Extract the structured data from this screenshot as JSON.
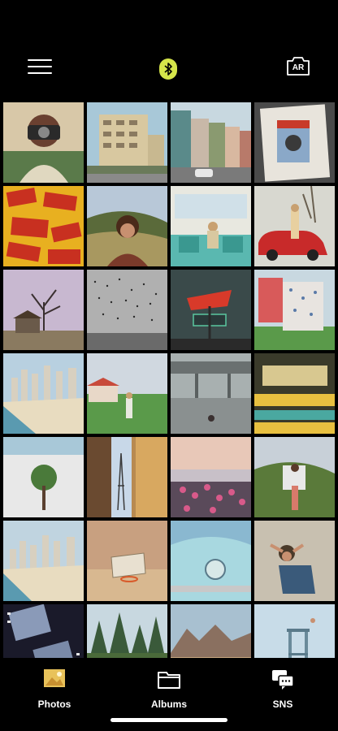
{
  "header": {
    "menu_icon": "hamburger-icon",
    "bluetooth_icon": "bluetooth-icon",
    "bluetooth_color": "#d6e64a",
    "ar_label": "AR",
    "ar_icon": "ar-camera-icon"
  },
  "grid": {
    "photos": [
      {
        "name": "photo-girl-camera"
      },
      {
        "name": "photo-apartment"
      },
      {
        "name": "photo-street-houses"
      },
      {
        "name": "photo-kodachrome-magazine"
      },
      {
        "name": "photo-kodak-film-boxes"
      },
      {
        "name": "photo-portrait-hills"
      },
      {
        "name": "photo-bus-interior"
      },
      {
        "name": "photo-red-car"
      },
      {
        "name": "photo-tree-house"
      },
      {
        "name": "photo-birds-flock"
      },
      {
        "name": "photo-inn-sign"
      },
      {
        "name": "photo-laundry-line"
      },
      {
        "name": "photo-beach-city"
      },
      {
        "name": "photo-garden-sprinkler"
      },
      {
        "name": "photo-overpass"
      },
      {
        "name": "photo-diner-interior"
      },
      {
        "name": "photo-small-tree"
      },
      {
        "name": "photo-eiffel-window"
      },
      {
        "name": "photo-flowers-sunset"
      },
      {
        "name": "photo-woman-hill"
      },
      {
        "name": "photo-beach-city-2"
      },
      {
        "name": "photo-basketball-hoop"
      },
      {
        "name": "photo-blue-car"
      },
      {
        "name": "photo-woman-lying"
      },
      {
        "name": "photo-film-strip"
      },
      {
        "name": "photo-pine-trees"
      },
      {
        "name": "photo-desert-mountains"
      },
      {
        "name": "photo-diving-tower"
      }
    ]
  },
  "tabs": [
    {
      "label": "Photos",
      "icon": "photos-icon",
      "active_color": "#e8c25a"
    },
    {
      "label": "Albums",
      "icon": "folder-icon"
    },
    {
      "label": "SNS",
      "icon": "chat-icon"
    }
  ]
}
